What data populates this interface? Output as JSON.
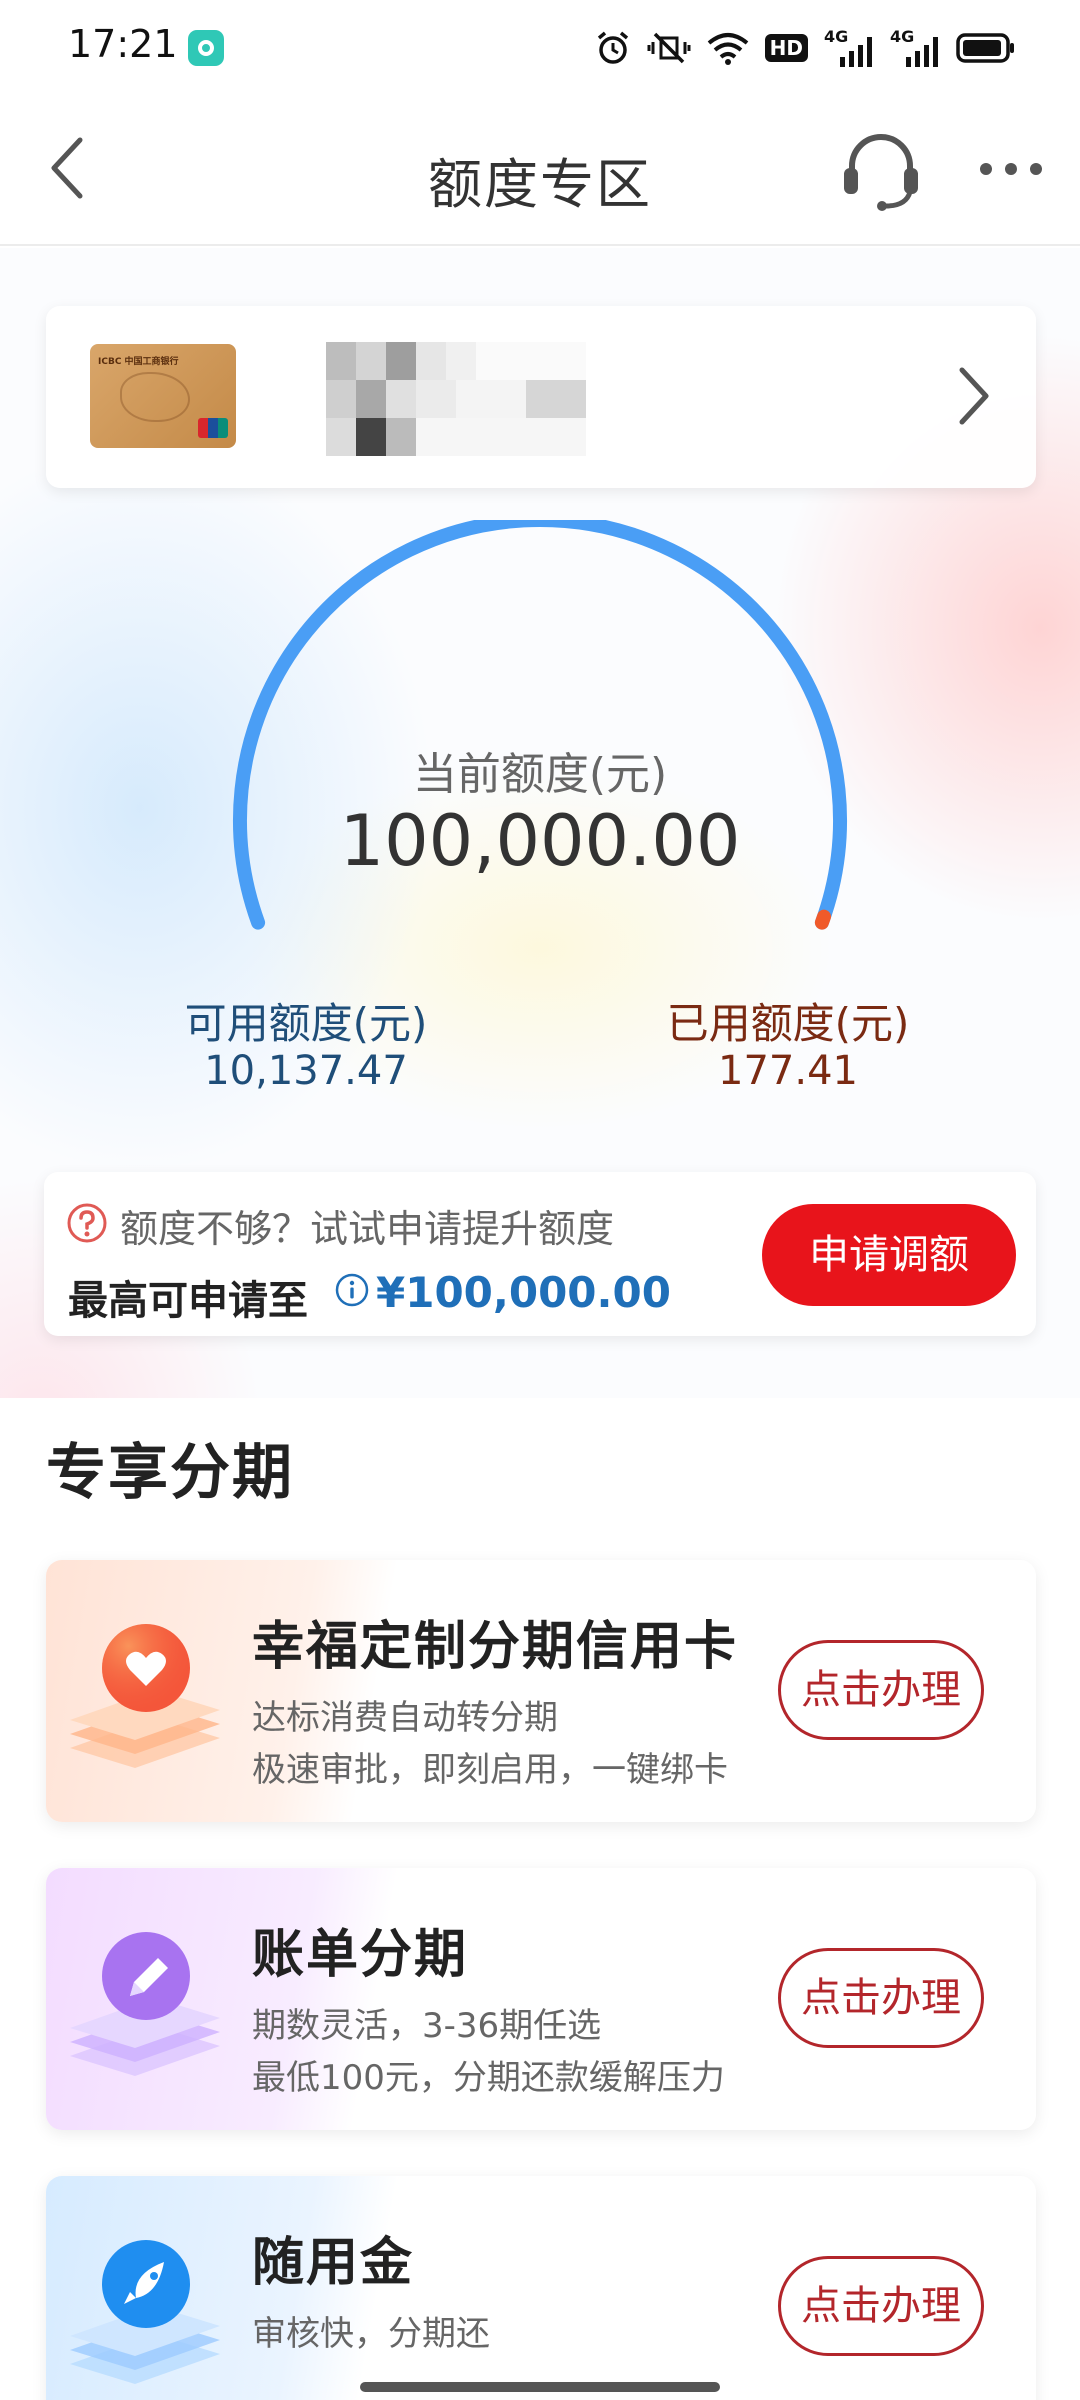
{
  "status_bar": {
    "time": "17:21",
    "hd_label": "HD",
    "net1": "4G",
    "net2": "4G",
    "icons": [
      "app-notification-icon",
      "alarm-icon",
      "vibrate-mute-icon",
      "wifi-icon",
      "hd-icon",
      "signal-icon",
      "signal-icon",
      "battery-icon"
    ]
  },
  "nav": {
    "title": "额度专区",
    "back_icon": "back-arrow-icon",
    "support_icon": "headset-icon",
    "more_icon": "more-dots-icon"
  },
  "card": {
    "thumb_bank_name": "ICBC 中国工商银行",
    "chevron_icon": "chevron-right-icon"
  },
  "gauge": {
    "caption": "当前额度(元)",
    "total": "100,000.00",
    "used_fraction": 0.0018,
    "track_color": "#4a9ef5",
    "used_color": "#f05a2a"
  },
  "available": {
    "label": "可用额度(元)",
    "value": "10,137.47"
  },
  "used": {
    "label": "已用额度(元)",
    "value": "177.41"
  },
  "promo": {
    "line1": "额度不够？试试申请提升额度",
    "line2_label": "最高可申请至",
    "amount": "¥100,000.00",
    "button": "申请调额"
  },
  "section_title": "专享分期",
  "offers": [
    {
      "title": "幸福定制分期信用卡",
      "desc1": "达标消费自动转分期",
      "desc2": "极速审批，即刻启用，一键绑卡",
      "button": "点击办理",
      "icon": "heart-icon"
    },
    {
      "title": "账单分期",
      "desc1": "期数灵活，3-36期任选",
      "desc2": "最低100元，分期还款缓解压力",
      "button": "点击办理",
      "icon": "pencil-icon"
    },
    {
      "title": "随用金",
      "desc1": "审核快，分期还",
      "desc2": "",
      "button": "点击办理",
      "icon": "rocket-icon"
    }
  ]
}
